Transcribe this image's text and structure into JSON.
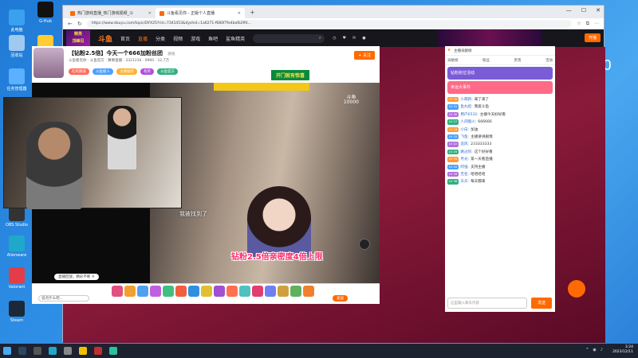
{
  "desktop": {
    "icons": [
      {
        "label": "此电脑",
        "name": "this-pc",
        "color": "#3aa0f0"
      },
      {
        "label": "回收站",
        "name": "recycle-bin",
        "color": "#9fc9ef"
      },
      {
        "label": "任务管理器",
        "name": "task-manager",
        "color": "#5bb0ff"
      },
      {
        "label": "新建文本文档",
        "name": "text-doc",
        "color": "#f3f3f3"
      },
      {
        "label": "G-Hub",
        "name": "ghub",
        "color": "#111111"
      },
      {
        "label": "QQ",
        "name": "qq",
        "color": "#ffcc33"
      },
      {
        "label": "OBS Studio",
        "name": "obs",
        "color": "#333333"
      },
      {
        "label": "Alienware",
        "name": "alienware",
        "color": "#1fa8c9"
      },
      {
        "label": "Valorant",
        "name": "valorant",
        "color": "#e33d4a"
      },
      {
        "label": "Steam",
        "name": "steam",
        "color": "#1b2838"
      }
    ],
    "overlay_text": "qzk530"
  },
  "browser": {
    "tabs": [
      {
        "label": "热门游戏直播_热门游戏视频_斗",
        "active": false
      },
      {
        "label": "斗鱼看见你 - 正版个人直播",
        "active": true
      }
    ],
    "url": "https://www.douyu.com/topic/DYX25?rid=7341453&dyshid=1a6271-f680f7fe4bafb2ffd...",
    "site_nav": [
      "首页",
      "直播",
      "分类",
      "视频",
      "游戏",
      "鱼吧",
      "鲨鱼精英"
    ],
    "site_nav_active": 1,
    "logo": "斗鱼",
    "promo_badge": "精英\n顶峰见",
    "live_button": "开播"
  },
  "room": {
    "title": "【钻粉2.5倍】今天一个666加粉丝团",
    "category": "颜值",
    "meta": "斗鱼看见你 · 斗鱼官方 · 赛事直播 · 3321234 · 9900 · 12.7万",
    "tags": [
      "吃鸡频道",
      "斗鱼新人",
      "主播推荐",
      "有奖",
      "斗鱼官方"
    ],
    "tag_colors": [
      "#ff6a5a",
      "#4aa0ff",
      "#ffb030",
      "#b050e0",
      "#30b080"
    ],
    "follow": "+ 关注",
    "ad": "开门就有惊喜"
  },
  "video": {
    "subtitle": "我被找到了",
    "promo": "钻粉2.5倍亲密度4倍上限",
    "watermark": "斗鱼\n10000",
    "tip": "直播回放，精彩不断 ✕"
  },
  "giftbar": {
    "chat_placeholder": "说点什么吧...",
    "send": "发送",
    "gift_colors": [
      "#e05080",
      "#f0a030",
      "#50a0f0",
      "#c060e0",
      "#40c080",
      "#f06040",
      "#3090e0",
      "#e0c030",
      "#a050d0",
      "#ff7050",
      "#50c0c0",
      "#e04070",
      "#7080f0",
      "#d0a040",
      "#60b060",
      "#f08030"
    ]
  },
  "chat": {
    "top_label": "主播贡献榜",
    "tabs": [
      "贡献榜",
      "粉丝",
      "贵宾",
      "活动"
    ],
    "cards": [
      {
        "label": "钻粉抢位活动",
        "color": "#7a5cd6"
      },
      {
        "label": "幸运大事件",
        "color": "#ff6a88"
      }
    ],
    "messages": [
      {
        "badge": "LV 25",
        "user": "小萌新:",
        "text": "来了来了"
      },
      {
        "badge": "LV 31",
        "user": "鱼丸控:",
        "text": "我爱斗鱼"
      },
      {
        "badge": "LV 40",
        "user": "用户6532:",
        "text": "主播今天好好看"
      },
      {
        "badge": "LV 27",
        "user": "人间烟火:",
        "text": "666666"
      },
      {
        "badge": "LV 18",
        "user": "小白:",
        "text": "加油"
      },
      {
        "badge": "LV 33",
        "user": "飞鱼:",
        "text": "主播讲讲剧情"
      },
      {
        "badge": "LV 22",
        "user": "追风:",
        "text": "233333333"
      },
      {
        "badge": "LV 29",
        "user": "路过的:",
        "text": "这个好好看"
      },
      {
        "badge": "LV 35",
        "user": "月光:",
        "text": "第一天看直播"
      },
      {
        "badge": "LV 20",
        "user": "阿强:",
        "text": "支持主播"
      },
      {
        "badge": "LV 26",
        "user": "无名:",
        "text": "哈哈哈哈"
      },
      {
        "badge": "LV 38",
        "user": "天天:",
        "text": "每天都来"
      }
    ],
    "input_placeholder": "这里输入聊天内容",
    "send": "发送"
  },
  "taskbar": {
    "time": "3:24",
    "date": "2023/12/11"
  },
  "colors": {
    "accent": "#ff6a00",
    "desktop": "#2f8fe6"
  }
}
